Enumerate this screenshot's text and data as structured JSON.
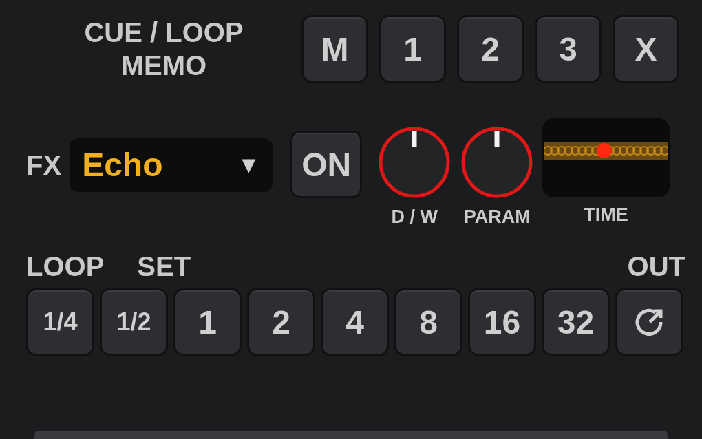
{
  "cue_loop_memo": {
    "label": [
      "CUE / LOOP",
      "MEMO"
    ],
    "buttons": [
      "M",
      "1",
      "2",
      "3",
      "X"
    ]
  },
  "fx": {
    "label": "FX",
    "effect": "Echo",
    "arrow": "▼",
    "on_button": {
      "label": "ON",
      "on": false
    },
    "knobs": [
      {
        "label": "D / W"
      },
      {
        "label": "PARAM"
      }
    ],
    "time": {
      "label": "TIME",
      "level": 0.48
    }
  },
  "loop": {
    "labels": [
      "LOOP",
      "SET"
    ],
    "out_label": "OUT",
    "buttons": [
      {
        "kind": "text",
        "label": "1/4"
      },
      {
        "kind": "text",
        "label": "1/2"
      },
      {
        "kind": "text",
        "label": "1"
      },
      {
        "kind": "text",
        "label": "2"
      },
      {
        "kind": "text",
        "label": "4"
      },
      {
        "kind": "text",
        "label": "8"
      },
      {
        "kind": "text",
        "label": "16"
      },
      {
        "kind": "text",
        "label": "32"
      },
      {
        "kind": "icon"
      }
    ]
  }
}
